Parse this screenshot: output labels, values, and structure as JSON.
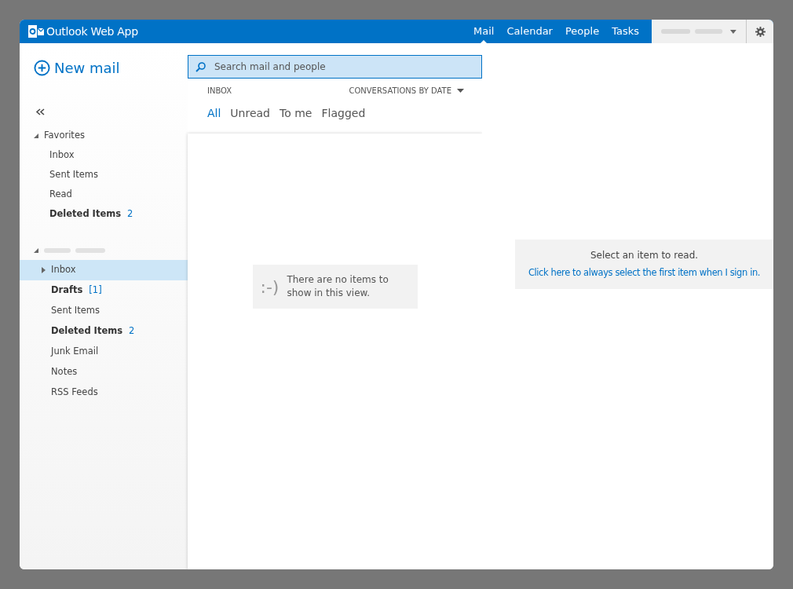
{
  "header": {
    "app_title": "Outlook Web App",
    "nav": [
      {
        "label": "Mail",
        "selected": true
      },
      {
        "label": "Calendar",
        "selected": false
      },
      {
        "label": "People",
        "selected": false
      },
      {
        "label": "Tasks",
        "selected": false
      }
    ]
  },
  "sidebar": {
    "new_mail": "New mail",
    "groups": [
      {
        "label": "Favorites",
        "expanded": true,
        "items": [
          {
            "label": "Inbox",
            "bold": false,
            "selected": false
          },
          {
            "label": "Sent Items",
            "bold": false,
            "selected": false
          },
          {
            "label": "Read",
            "bold": false,
            "selected": false
          },
          {
            "label": "Deleted Items",
            "count": "2",
            "bold": true,
            "selected": false
          }
        ]
      },
      {
        "expanded": true,
        "items": [
          {
            "label": "Inbox",
            "bold": false,
            "selected": true,
            "expanded": false
          },
          {
            "label": "Drafts",
            "count": "[1]",
            "bold": true,
            "selected": false
          },
          {
            "label": "Sent Items",
            "bold": false,
            "selected": false
          },
          {
            "label": "Deleted Items",
            "count": "2",
            "bold": true,
            "selected": false
          },
          {
            "label": "Junk Email",
            "bold": false,
            "selected": false
          },
          {
            "label": "Notes",
            "bold": false,
            "selected": false
          },
          {
            "label": "RSS Feeds",
            "bold": false,
            "selected": false
          }
        ]
      }
    ]
  },
  "message_list": {
    "search": {
      "placeholder": "Search mail and people"
    },
    "folder_title": "INBOX",
    "sort": "CONVERSATIONS BY DATE",
    "filters": [
      {
        "label": "All",
        "selected": true
      },
      {
        "label": "Unread",
        "selected": false
      },
      {
        "label": "To me",
        "selected": false
      },
      {
        "label": "Flagged",
        "selected": false
      }
    ],
    "empty": {
      "emoticon": ":-)",
      "message": "There are no items to show in this view."
    }
  },
  "reading_pane": {
    "message": "Select an item to read.",
    "link": "Click here to always select the first item when I sign in."
  }
}
